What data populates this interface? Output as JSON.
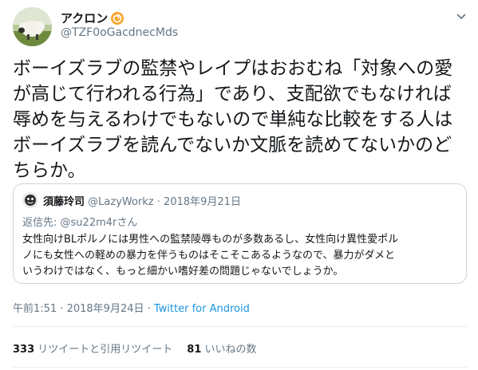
{
  "tweet": {
    "display_name": "アクロン",
    "handle": "@TZF0oGacdnecMds",
    "text_lines": [
      "ボーイズラブの監禁やレイプはおおむね「対象への愛",
      "が高じて行われる行為」であり、支配欲でもなければ",
      "辱めを与えるわけでもないので単純な比較をする人は",
      "ボーイズラブを読んでないか文脈を読めてないかのど",
      "ちらか。"
    ],
    "quote": {
      "display_name": "須藤玲司",
      "handle": "@LazyWorkz",
      "separator": "·",
      "date": "2018年9月21日",
      "reply_prefix": "返信先:",
      "reply_mention": "@su22m4rさん",
      "text_lines": [
        "女性向けBLポルノには男性への監禁陵辱ものが多数あるし、女性向け異性愛ポル",
        "ノにも女性への軽めの暴力を伴うものはそこそこあるようなので、暴力がダメと",
        "いうわけではなく、もっと細かい嗜好差の問題じゃないでしょうか。"
      ]
    },
    "timestamp": "午前1:51 · 2018年9月24日 · ",
    "source": "Twitter for Android",
    "stats": {
      "retweets_count": "333",
      "retweets_label": "リツイートと引用リツイート",
      "likes_count": "81",
      "likes_label": "いいねの数"
    }
  },
  "colors": {
    "text": "#14171a",
    "secondary": "#657786",
    "link": "#1b95e0",
    "border": "#ccd6dd",
    "divider": "#e6ecf0"
  },
  "icons": {
    "name_badge": "orange-swirl-icon",
    "menu": "chevron-down-icon"
  }
}
